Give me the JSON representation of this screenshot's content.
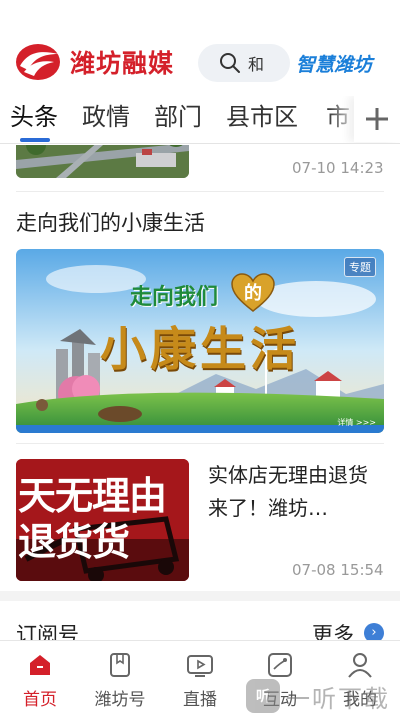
{
  "header": {
    "logo_text": "潍坊融媒",
    "search_placeholder": "和",
    "brand_secondary": "智慧潍坊",
    "accent_color": "#d4202a"
  },
  "tabs": {
    "items": [
      {
        "label": "头条"
      },
      {
        "label": "政情"
      },
      {
        "label": "部门"
      },
      {
        "label": "县市区"
      },
      {
        "label": "市"
      }
    ],
    "active_index": 0,
    "add_icon": "plus-icon"
  },
  "feed": {
    "item1": {
      "time": "07-10 14:23"
    },
    "item2": {
      "title": "走向我们的小康生活",
      "banner_tag": "专题",
      "banner_line1": "走向我们",
      "banner_heart_text": "的",
      "banner_line2": "小康生活",
      "banner_more": "详情 >>>"
    },
    "item3": {
      "thumb_line1": "天无理由",
      "thumb_line2": "退货货",
      "title": "实体店无理由退货来了！潍坊…",
      "time": "07-08 15:54"
    },
    "subscriptions": {
      "title": "订阅号",
      "more_label": "更多"
    }
  },
  "bottom_nav": {
    "items": [
      {
        "label": "首页",
        "icon": "home-icon"
      },
      {
        "label": "潍坊号",
        "icon": "bookmark-icon"
      },
      {
        "label": "直播",
        "icon": "tv-play-icon"
      },
      {
        "label": "互动",
        "icon": "interact-icon"
      },
      {
        "label": "我的",
        "icon": "user-icon"
      }
    ],
    "active_index": 0
  },
  "watermark": {
    "box": "听",
    "text": "一听下载"
  }
}
